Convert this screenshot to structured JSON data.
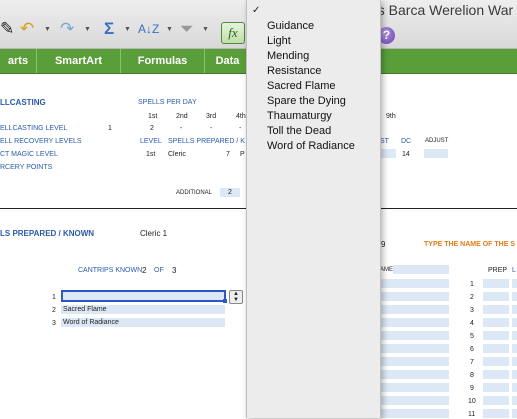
{
  "window": {
    "title_fragment": "us Barca Werelion War"
  },
  "ribbon_tabs": [
    "arts",
    "SmartArt",
    "Formulas",
    "Data"
  ],
  "toolbar": {
    "icons": [
      "undo-icon",
      "redo-icon",
      "autosum-icon",
      "sort-icon",
      "filter-icon",
      "function-icon",
      "help-icon"
    ],
    "fx_label": "fx",
    "help_label": "?"
  },
  "dropdown": {
    "checkmark": "✓",
    "items": [
      "Guidance",
      "Light",
      "Mending",
      "Resistance",
      "Sacred Flame",
      "Spare the Dying",
      "Thaumaturgy",
      "Toll the Dead",
      "Word of Radiance"
    ]
  },
  "spellcasting": {
    "header": "LLCASTING",
    "spells_per_day": "SPELLS PER DAY",
    "level_cols": [
      "1st",
      "2nd",
      "3rd",
      "4th"
    ],
    "level_9": "9th",
    "rows": [
      "ELLCASTING LEVEL",
      "ELL RECOVERY LEVELS",
      "CT MAGIC LEVEL",
      "RCERY POINTS"
    ],
    "spellcasting_level_value": "1",
    "per_day_values": [
      "2",
      "-",
      "-",
      "-"
    ],
    "level_label": "LEVEL",
    "spells_prepared_label": "SPELLS PREPARED / K",
    "level_value": "1st",
    "class_value": "Cleric",
    "prepared_value": "7",
    "pr_fragment": "P",
    "st_fragment": "ST",
    "dc_label": "DC",
    "adjust_label": "ADJUST",
    "dc_value": "14",
    "additional_label": "ADDITIONAL",
    "additional_value": "2"
  },
  "prepared": {
    "header": "LS PREPARED / KNOWN",
    "class_label": "Cleric 1",
    "nine": "9",
    "type_name_label": "TYPE THE NAME OF THE S",
    "cantrips_label": "CANTRIPS KNOWN",
    "cantrips_count": "2",
    "of_label": "OF",
    "cantrips_total": "3",
    "ame_fragment": "AME",
    "prep_label": "PREP",
    "l_fragment": "L",
    "rows": [
      {
        "num": "1",
        "name": ""
      },
      {
        "num": "2",
        "name": "Sacred Flame"
      },
      {
        "num": "3",
        "name": "Word of Radiance"
      }
    ],
    "right_rows": [
      "1",
      "2",
      "3",
      "4",
      "5",
      "6",
      "7",
      "8",
      "9",
      "10",
      "11"
    ]
  }
}
